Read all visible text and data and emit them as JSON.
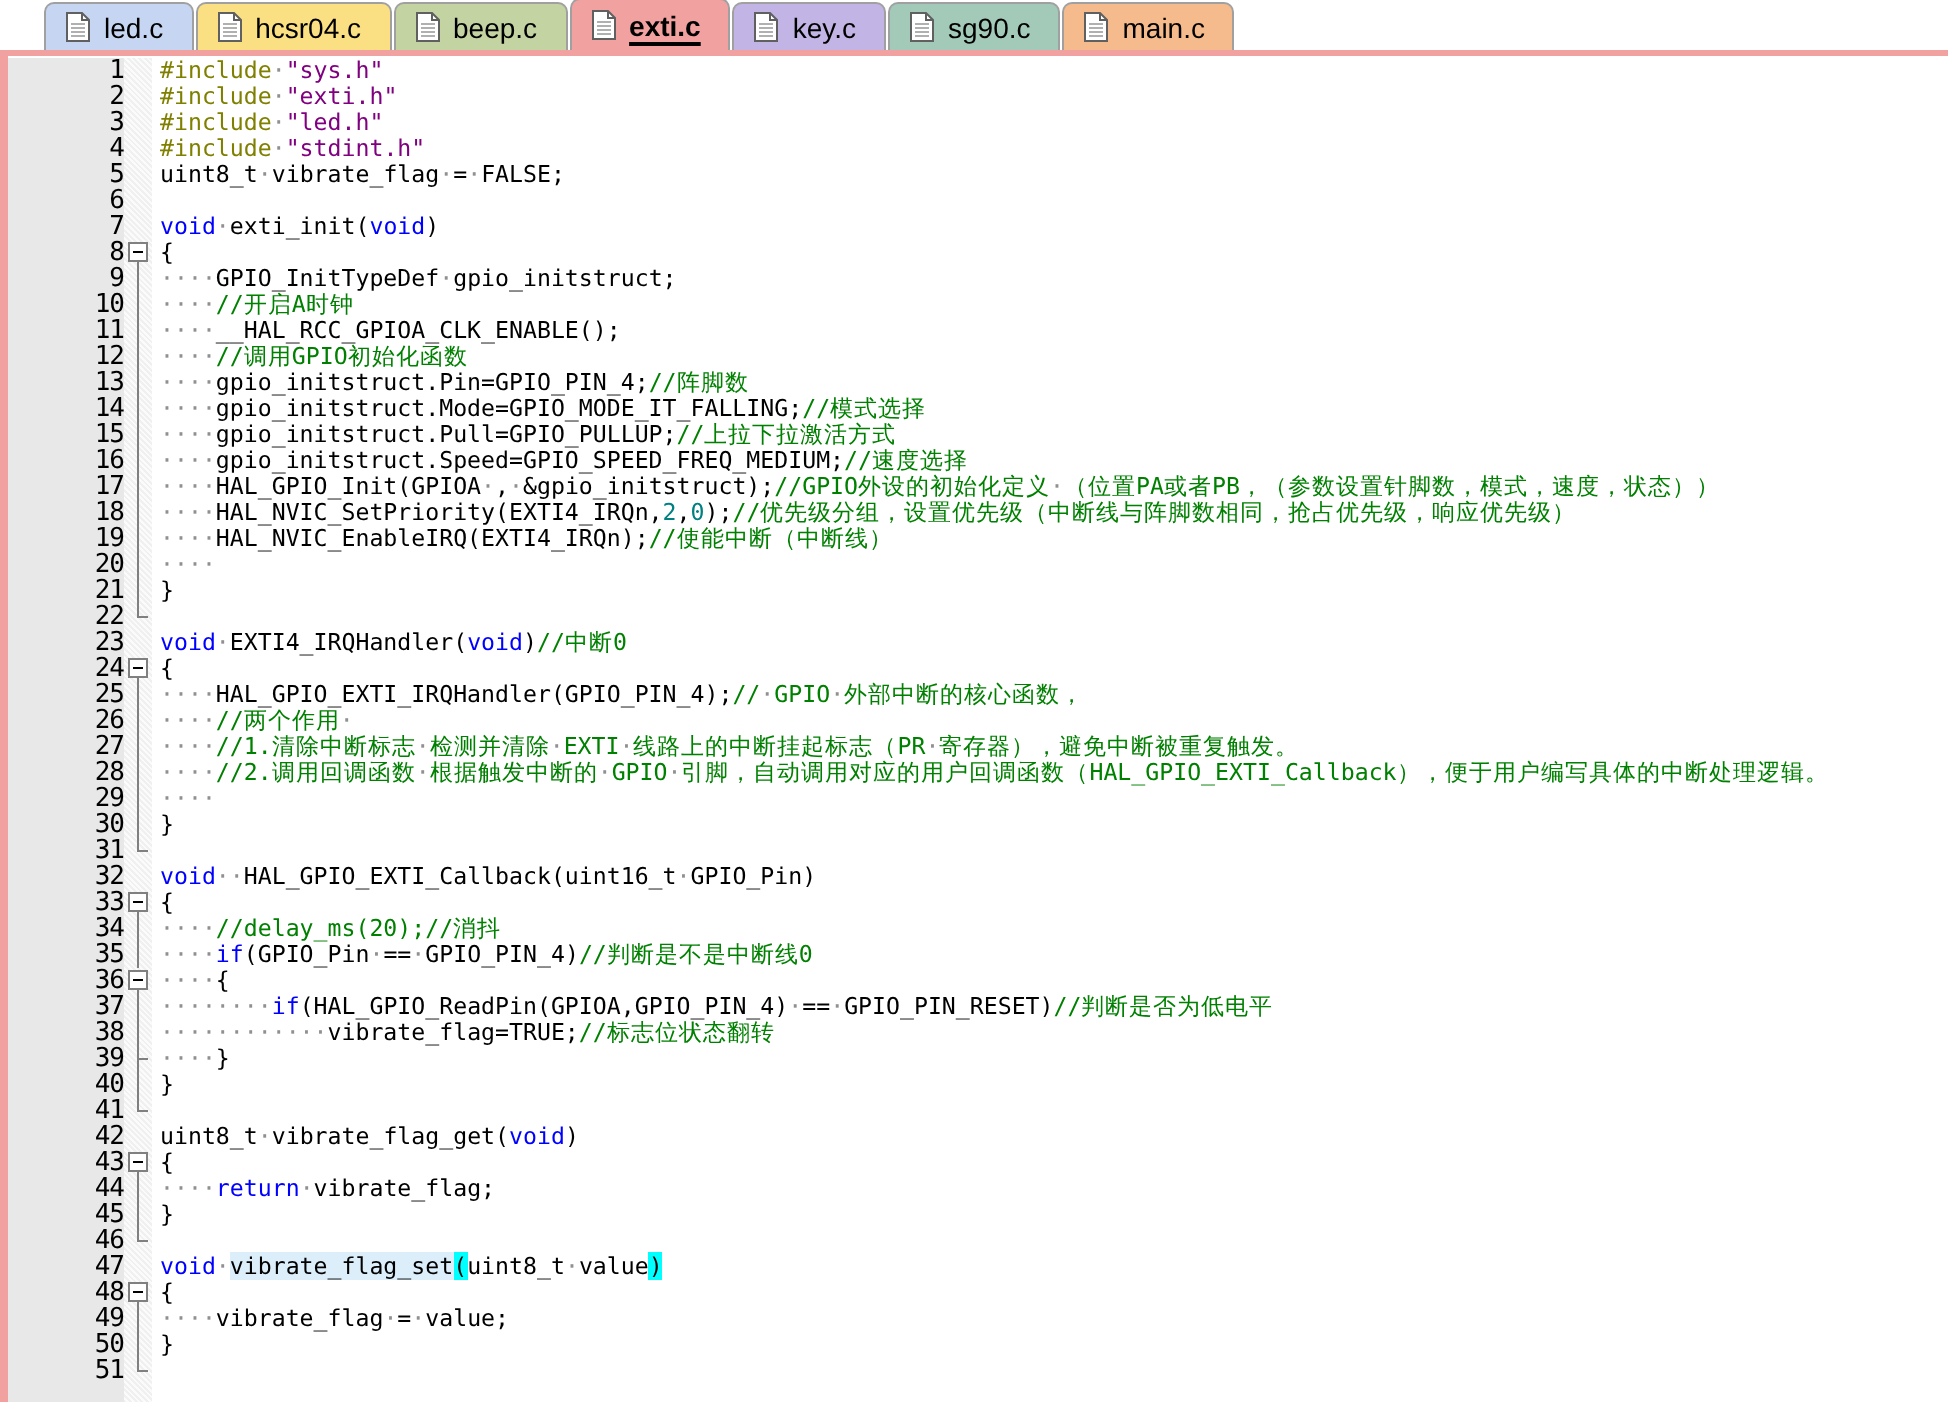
{
  "tabs": [
    {
      "label": "led.c",
      "selected": false,
      "color": "#c6d6f2"
    },
    {
      "label": "hcsr04.c",
      "selected": false,
      "color": "#fbe083"
    },
    {
      "label": "beep.c",
      "selected": false,
      "color": "#c3d3a2"
    },
    {
      "label": "exti.c",
      "selected": true,
      "color": "#f2a1a1"
    },
    {
      "label": "key.c",
      "selected": false,
      "color": "#c2b4e4"
    },
    {
      "label": "sg90.c",
      "selected": false,
      "color": "#a3c9b9"
    },
    {
      "label": "main.c",
      "selected": false,
      "color": "#f6bb8c"
    }
  ],
  "editor": {
    "lines": [
      {
        "number": "1",
        "kind": "line",
        "tokens": [
          {
            "kind": "directive",
            "text": "#include·"
          },
          {
            "kind": "string",
            "text": "\"sys.h\""
          }
        ]
      },
      {
        "number": "2",
        "kind": "line",
        "tokens": [
          {
            "kind": "directive",
            "text": "#include·"
          },
          {
            "kind": "string",
            "text": "\"exti.h\""
          }
        ]
      },
      {
        "number": "3",
        "kind": "line",
        "tokens": [
          {
            "kind": "directive",
            "text": "#include·"
          },
          {
            "kind": "string",
            "text": "\"led.h\""
          }
        ]
      },
      {
        "number": "4",
        "kind": "line",
        "tokens": [
          {
            "kind": "directive",
            "text": "#include·"
          },
          {
            "kind": "string",
            "text": "\"stdint.h\""
          }
        ]
      },
      {
        "number": "5",
        "kind": "line",
        "tokens": [
          {
            "kind": "plain",
            "text": "uint8_t·vibrate_flag·=·FALSE;"
          }
        ]
      },
      {
        "number": "6",
        "kind": "line"
      },
      {
        "number": "7",
        "kind": "line",
        "tokens": [
          {
            "kind": "keyword",
            "text": "void"
          },
          {
            "kind": "plain",
            "text": "·exti_init("
          },
          {
            "kind": "keyword",
            "text": "void"
          },
          {
            "kind": "plain",
            "text": ")"
          }
        ]
      },
      {
        "number": "8",
        "kind": "fold-start",
        "tokens": [
          {
            "kind": "plain",
            "text": "{"
          }
        ]
      },
      {
        "number": "9",
        "kind": "fold-inner",
        "tokens": [
          {
            "kind": "plain",
            "text": "····GPIO_InitTypeDef·gpio_initstruct;"
          }
        ]
      },
      {
        "number": "10",
        "kind": "fold-inner",
        "tokens": [
          {
            "kind": "plain",
            "text": "····"
          },
          {
            "kind": "comment",
            "text": "//开启A时钟"
          }
        ]
      },
      {
        "number": "11",
        "kind": "fold-inner",
        "tokens": [
          {
            "kind": "plain",
            "text": "····__HAL_RCC_GPIOA_CLK_ENABLE();"
          }
        ]
      },
      {
        "number": "12",
        "kind": "fold-inner",
        "tokens": [
          {
            "kind": "plain",
            "text": "····"
          },
          {
            "kind": "comment",
            "text": "//调用GPIO初始化函数"
          }
        ]
      },
      {
        "number": "13",
        "kind": "fold-inner",
        "tokens": [
          {
            "kind": "plain",
            "text": "····gpio_initstruct.Pin=GPIO_PIN_4;"
          },
          {
            "kind": "comment",
            "text": "//阵脚数"
          }
        ]
      },
      {
        "number": "14",
        "kind": "fold-inner",
        "tokens": [
          {
            "kind": "plain",
            "text": "····gpio_initstruct.Mode=GPIO_MODE_IT_FALLING;"
          },
          {
            "kind": "comment",
            "text": "//模式选择"
          }
        ]
      },
      {
        "number": "15",
        "kind": "fold-inner",
        "tokens": [
          {
            "kind": "plain",
            "text": "····gpio_initstruct.Pull=GPIO_PULLUP;"
          },
          {
            "kind": "comment",
            "text": "//上拉下拉激活方式"
          }
        ]
      },
      {
        "number": "16",
        "kind": "fold-inner",
        "tokens": [
          {
            "kind": "plain",
            "text": "····gpio_initstruct.Speed=GPIO_SPEED_FREQ_MEDIUM;"
          },
          {
            "kind": "comment",
            "text": "//速度选择"
          }
        ]
      },
      {
        "number": "17",
        "kind": "fold-inner",
        "tokens": [
          {
            "kind": "plain",
            "text": "····HAL_GPIO_Init(GPIOA·,·&gpio_initstruct);"
          },
          {
            "kind": "comment",
            "text": "//GPIO外设的初始化定义·（位置PA或者PB，（参数设置针脚数，模式，速度，状态））"
          }
        ]
      },
      {
        "number": "18",
        "kind": "fold-inner",
        "tokens": [
          {
            "kind": "plain",
            "text": "····HAL_NVIC_SetPriority(EXTI4_IRQn,"
          },
          {
            "kind": "number",
            "text": "2,0"
          },
          {
            "kind": "plain",
            "text": ");"
          },
          {
            "kind": "comment",
            "text": "//优先级分组，设置优先级（中断线与阵脚数相同，抢占优先级，响应优先级）"
          }
        ]
      },
      {
        "number": "19",
        "kind": "fold-inner",
        "tokens": [
          {
            "kind": "plain",
            "text": "····HAL_NVIC_EnableIRQ(EXTI4_IRQn);"
          },
          {
            "kind": "comment",
            "text": "//使能中断（中断线）"
          }
        ]
      },
      {
        "number": "20",
        "kind": "fold-inner",
        "tokens": [
          {
            "kind": "plain",
            "text": "····"
          }
        ]
      },
      {
        "number": "21",
        "kind": "fold-inner",
        "tokens": [
          {
            "kind": "plain",
            "text": "}"
          }
        ]
      },
      {
        "number": "22",
        "kind": "fold-end"
      },
      {
        "number": "23",
        "kind": "line",
        "tokens": [
          {
            "kind": "keyword",
            "text": "void"
          },
          {
            "kind": "plain",
            "text": "·EXTI4_IRQHandler("
          },
          {
            "kind": "keyword",
            "text": "void"
          },
          {
            "kind": "plain",
            "text": ")"
          },
          {
            "kind": "comment",
            "text": "//中断0"
          }
        ]
      },
      {
        "number": "24",
        "kind": "fold-start",
        "tokens": [
          {
            "kind": "plain",
            "text": "{"
          }
        ]
      },
      {
        "number": "25",
        "kind": "fold-inner",
        "tokens": [
          {
            "kind": "plain",
            "text": "····HAL_GPIO_EXTI_IRQHandler(GPIO_PIN_4);"
          },
          {
            "kind": "comment",
            "text": "//·GPIO·外部中断的核心函数，"
          }
        ]
      },
      {
        "number": "26",
        "kind": "fold-inner",
        "tokens": [
          {
            "kind": "plain",
            "text": "····"
          },
          {
            "kind": "comment",
            "text": "//两个作用·"
          }
        ]
      },
      {
        "number": "27",
        "kind": "fold-inner",
        "tokens": [
          {
            "kind": "plain",
            "text": "····"
          },
          {
            "kind": "comment",
            "text": "//1.清除中断标志·检测并清除·EXTI·线路上的中断挂起标志（PR·寄存器），避免中断被重复触发。"
          }
        ]
      },
      {
        "number": "28",
        "kind": "fold-inner",
        "tokens": [
          {
            "kind": "plain",
            "text": "····"
          },
          {
            "kind": "comment",
            "text": "//2.调用回调函数·根据触发中断的·GPIO·引脚，自动调用对应的用户回调函数（HAL_GPIO_EXTI_Callback），便于用户编写具体的中断处理逻辑。"
          }
        ]
      },
      {
        "number": "29",
        "kind": "fold-inner",
        "tokens": [
          {
            "kind": "plain",
            "text": "····"
          }
        ]
      },
      {
        "number": "30",
        "kind": "fold-inner",
        "tokens": [
          {
            "kind": "plain",
            "text": "}"
          }
        ]
      },
      {
        "number": "31",
        "kind": "fold-end"
      },
      {
        "number": "32",
        "kind": "line",
        "tokens": [
          {
            "kind": "keyword",
            "text": "void"
          },
          {
            "kind": "plain",
            "text": "··HAL_GPIO_EXTI_Callback(uint16_t·GPIO_Pin)"
          }
        ]
      },
      {
        "number": "33",
        "kind": "fold-start",
        "tokens": [
          {
            "kind": "plain",
            "text": "{"
          }
        ]
      },
      {
        "number": "34",
        "kind": "fold-inner",
        "tokens": [
          {
            "kind": "plain",
            "text": "····"
          },
          {
            "kind": "comment",
            "text": "//delay_ms(20);//消抖"
          }
        ]
      },
      {
        "number": "35",
        "kind": "fold-inner",
        "tokens": [
          {
            "kind": "plain",
            "text": "····"
          },
          {
            "kind": "keyword",
            "text": "if"
          },
          {
            "kind": "plain",
            "text": "(GPIO_Pin·==·GPIO_PIN_4)"
          },
          {
            "kind": "comment",
            "text": "//判断是不是中断线0"
          }
        ]
      },
      {
        "number": "36",
        "kind": "fold-start",
        "tokens": [
          {
            "kind": "plain",
            "text": "····{"
          }
        ]
      },
      {
        "number": "37",
        "kind": "fold-inner",
        "tokens": [
          {
            "kind": "plain",
            "text": "········"
          },
          {
            "kind": "keyword",
            "text": "if"
          },
          {
            "kind": "plain",
            "text": "(HAL_GPIO_ReadPin(GPIOA,GPIO_PIN_4)·==·GPIO_PIN_RESET)"
          },
          {
            "kind": "comment",
            "text": "//判断是否为低电平"
          }
        ]
      },
      {
        "number": "38",
        "kind": "fold-inner",
        "tokens": [
          {
            "kind": "plain",
            "text": "············vibrate_flag=TRUE;"
          },
          {
            "kind": "comment",
            "text": "//标志位状态翻转"
          }
        ]
      },
      {
        "number": "39",
        "kind": "fold-branch",
        "tokens": [
          {
            "kind": "plain",
            "text": "····}"
          }
        ]
      },
      {
        "number": "40",
        "kind": "fold-inner",
        "tokens": [
          {
            "kind": "plain",
            "text": "}"
          }
        ]
      },
      {
        "number": "41",
        "kind": "fold-end"
      },
      {
        "number": "42",
        "kind": "line",
        "tokens": [
          {
            "kind": "plain",
            "text": "uint8_t·vibrate_flag_get("
          },
          {
            "kind": "keyword",
            "text": "void"
          },
          {
            "kind": "plain",
            "text": ")"
          }
        ]
      },
      {
        "number": "43",
        "kind": "fold-start",
        "tokens": [
          {
            "kind": "plain",
            "text": "{"
          }
        ]
      },
      {
        "number": "44",
        "kind": "fold-inner",
        "tokens": [
          {
            "kind": "plain",
            "text": "····"
          },
          {
            "kind": "keyword",
            "text": "return"
          },
          {
            "kind": "plain",
            "text": "·vibrate_flag;"
          }
        ]
      },
      {
        "number": "45",
        "kind": "fold-inner",
        "tokens": [
          {
            "kind": "plain",
            "text": "}"
          }
        ]
      },
      {
        "number": "46",
        "kind": "fold-end"
      },
      {
        "number": "47",
        "kind": "line",
        "tokens": [
          {
            "kind": "keyword",
            "text": "void"
          },
          {
            "kind": "plain",
            "text": "·"
          },
          {
            "kind": "word-highlight",
            "text": "vibrate_flag_set"
          },
          {
            "kind": "brace-match",
            "text": "("
          },
          {
            "kind": "plain",
            "text": "uint8_t·value"
          },
          {
            "kind": "brace-match",
            "text": ")"
          }
        ]
      },
      {
        "number": "48",
        "kind": "fold-start",
        "tokens": [
          {
            "kind": "plain",
            "text": "{"
          }
        ]
      },
      {
        "number": "49",
        "kind": "fold-inner",
        "tokens": [
          {
            "kind": "plain",
            "text": "····vibrate_flag·=·value;"
          }
        ]
      },
      {
        "number": "50",
        "kind": "fold-inner",
        "tokens": [
          {
            "kind": "plain",
            "text": "}"
          }
        ]
      },
      {
        "number": "51",
        "kind": "fold-end"
      }
    ]
  }
}
